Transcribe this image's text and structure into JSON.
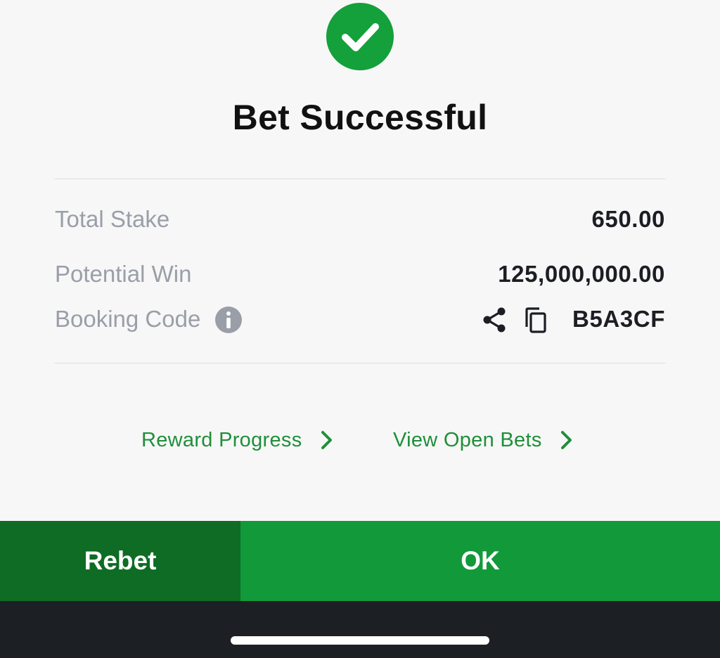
{
  "header": {
    "title": "Bet Successful",
    "icon": "checkmark-circle-icon",
    "icon_color": "#14a03b"
  },
  "summary": {
    "total_stake_label": "Total Stake",
    "total_stake_value": "650.00",
    "potential_win_label": "Potential Win",
    "potential_win_value": "125,000,000.00",
    "booking_code_label": "Booking Code",
    "booking_code_value": "B5A3CF",
    "info_icon": "info-icon",
    "share_icon": "share-icon",
    "copy_icon": "copy-icon"
  },
  "links": {
    "reward_progress": "Reward Progress",
    "view_open_bets": "View Open Bets",
    "link_color": "#1f8f3a"
  },
  "actions": {
    "rebet_label": "Rebet",
    "ok_label": "OK",
    "rebet_color": "#0e6c24",
    "ok_color": "#12993a"
  }
}
